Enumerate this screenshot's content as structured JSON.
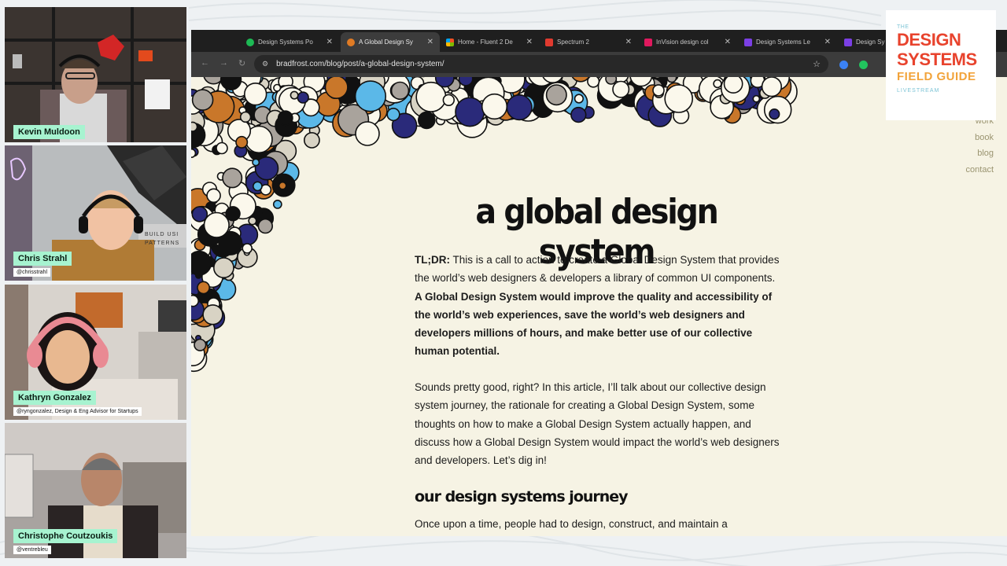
{
  "participants": [
    {
      "name": "Kevin Muldoon",
      "handle": ""
    },
    {
      "name": "Chris Strahl",
      "handle": "@chrisstrahl"
    },
    {
      "name": "Kathryn Gonzalez",
      "handle": "@ryngonzalez, Design & Eng Advisor for Startups"
    },
    {
      "name": "Christophe Coutzoukis",
      "handle": "@ventrebleu"
    }
  ],
  "scene_text": {
    "build_sign": "BUILD USI PATTERNS"
  },
  "browser": {
    "tabs": [
      {
        "label": "Design Systems Po",
        "favicon_color": "#1db954",
        "active": false
      },
      {
        "label": "A Global Design Sy",
        "favicon_color": "#e07b24",
        "active": true
      },
      {
        "label": "Home - Fluent 2 De",
        "favicon_color": "#f25022",
        "active": false
      },
      {
        "label": "Spectrum 2",
        "favicon_color": "#e03a2f",
        "active": false
      },
      {
        "label": "InVision design col",
        "favicon_color": "#e0195e",
        "active": false
      },
      {
        "label": "Design Systems Le",
        "favicon_color": "#7b3fe4",
        "active": false
      },
      {
        "label": "Design Sy",
        "favicon_color": "#7b3fe4",
        "active": false
      }
    ],
    "url": "bradfrost.com/blog/post/a-global-design-system/",
    "nav": {
      "back": "←",
      "forward": "→",
      "reload": "↻",
      "star": "☆"
    }
  },
  "site_nav": [
    "work",
    "book",
    "blog",
    "contact"
  ],
  "article": {
    "title": "a global design system",
    "tldr_label": "TL;DR:",
    "tldr_text": " This is a call to action to create a Global Design System that provides the world’s web designers & developers a library of common UI components. ",
    "tldr_bold": "A Global Design System would improve the quality and accessibility of the world’s web experiences, save the world’s web designers and developers millions of hours, and make better use of our collective human potential.",
    "para2": "Sounds pretty good, right? In this article, I’ll talk about our collective design system journey, the rationale for creating a Global Design System, some thoughts on how to make a Global Design System actually happen, and discuss how a Global Design System would impact the world’s web designers and developers. Let’s dig in!",
    "heading2": "our design systems journey",
    "para3": "Once upon a time, people had to design, construct, and maintain a"
  },
  "logo": {
    "the": "THE",
    "line1": "DESIGN",
    "line2": "SYSTEMS",
    "line3": "FIELD GUIDE",
    "line4": "LIVESTREAM"
  },
  "colors": {
    "name_tag_bg": "#a7f3d0",
    "page_bg": "#f6f3e4",
    "logo_red": "#e8432d",
    "logo_orange": "#f2a33a",
    "logo_teal": "#7dc4d6"
  }
}
